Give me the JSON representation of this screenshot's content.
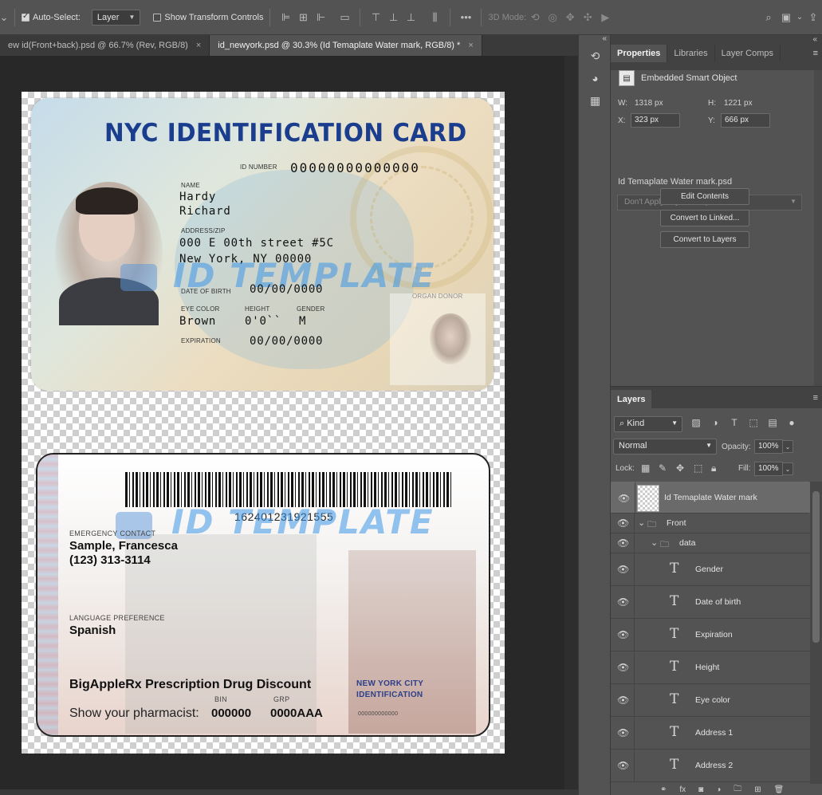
{
  "options_bar": {
    "auto_select_label": "Auto-Select:",
    "layer_select": "Layer",
    "show_transform_label": "Show Transform Controls",
    "mode_3d_label": "3D Mode:",
    "more": "•••"
  },
  "tabs": [
    {
      "label": "ew id(Front+back).psd @ 66.7% (Rev, RGB/8)",
      "close": "×"
    },
    {
      "label": "id_newyork.psd @ 30.3% (Id Temaplate Water mark, RGB/8) *",
      "close": "×"
    }
  ],
  "card_front": {
    "title": "NYC IDENTIFICATION CARD",
    "id_number_label": "ID NUMBER",
    "id_number": "00000000000000",
    "name_label": "NAME",
    "first_name": "Hardy",
    "last_name": "Richard",
    "address_label": "ADDRESS/ZIP",
    "address_line1": "000 E 00th street #5C",
    "address_line2": "New York, NY 00000",
    "dob_label": "DATE OF BIRTH",
    "dob": "00/00/0000",
    "eye_color_label": "EYE COLOR",
    "eye_color": "Brown",
    "height_label": "HEIGHT",
    "height": "0'0``",
    "gender_label": "GENDER",
    "gender": "M",
    "expiration_label": "EXPIRATION",
    "expiration": "00/00/0000",
    "organ_donor_label": "ORGAN DONOR",
    "watermark": "ID TEMPLATE"
  },
  "card_back": {
    "barcode_number": "162401231921555",
    "watermark": "ID TEMPLATE",
    "emergency_label": "EMERGENCY CONTACT",
    "emergency_name": "Sample, Francesca",
    "emergency_phone": "(123) 313-3114",
    "language_label": "LANGUAGE PREFERENCE",
    "language": "Spanish",
    "rx_title": "BigAppleRx Prescription Drug Discount",
    "pharmacist_label": "Show your pharmacist:",
    "bin_label": "BIN",
    "bin": "000000",
    "grp_label": "GRP",
    "grp": "0000AAA",
    "nyc_id_line1": "NEW YORK CITY",
    "nyc_id_line2": "IDENTIFICATION",
    "small_number": "000000000000"
  },
  "properties": {
    "tabs": [
      "Properties",
      "Libraries",
      "Layer Comps"
    ],
    "object_type": "Embedded Smart Object",
    "w_label": "W:",
    "w_value": "1318 px",
    "h_label": "H:",
    "h_value": "1221 px",
    "x_label": "X:",
    "x_value": "323 px",
    "y_label": "Y:",
    "y_value": "666 px",
    "filename": "Id Temaplate Water mark.psd",
    "layer_comp": "Don't Apply Layer Comp",
    "buttons": [
      "Edit Contents",
      "Convert to Linked...",
      "Convert to Layers"
    ]
  },
  "layers": {
    "tab": "Layers",
    "kind": "Kind",
    "blend_mode": "Normal",
    "opacity_label": "Opacity:",
    "opacity": "100%",
    "lock_label": "Lock:",
    "fill_label": "Fill:",
    "fill": "100%",
    "items": [
      {
        "name": "Id Temaplate Water mark",
        "type": "smart"
      },
      {
        "name": "Front",
        "type": "group"
      },
      {
        "name": "data",
        "type": "group"
      },
      {
        "name": "Gender",
        "type": "text"
      },
      {
        "name": "Date of birth",
        "type": "text"
      },
      {
        "name": "Expiration",
        "type": "text"
      },
      {
        "name": "Height",
        "type": "text"
      },
      {
        "name": "Eye color",
        "type": "text"
      },
      {
        "name": "Address 1",
        "type": "text"
      },
      {
        "name": "Address 2",
        "type": "text"
      }
    ]
  }
}
